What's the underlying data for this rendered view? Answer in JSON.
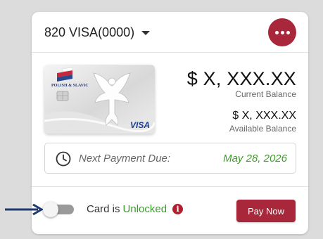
{
  "header": {
    "account_prefix": "820 VISA ",
    "account_number": "(0000)"
  },
  "card": {
    "issuer_text": "POLISH & SLAVIC",
    "brand": "VISA"
  },
  "balances": {
    "current_amount": "$ X, XXX.XX",
    "current_label": "Current Balance",
    "available_amount": "$ X, XXX.XX",
    "available_label": "Available Balance"
  },
  "payment": {
    "label": "Next Payment Due:",
    "date": "May 28, 2026"
  },
  "lock": {
    "prefix": "Card is",
    "status": "Unlocked",
    "info_glyph": "i",
    "toggle_on": false
  },
  "actions": {
    "pay_now_label": "Pay Now"
  },
  "colors": {
    "accent": "#a8273a",
    "positive": "#3a9a2b",
    "arrow": "#1f3a6b"
  },
  "icons": {
    "more": "more-horizontal-icon",
    "clock": "clock-icon",
    "info": "info-icon",
    "arrow": "arrow-right-icon"
  }
}
